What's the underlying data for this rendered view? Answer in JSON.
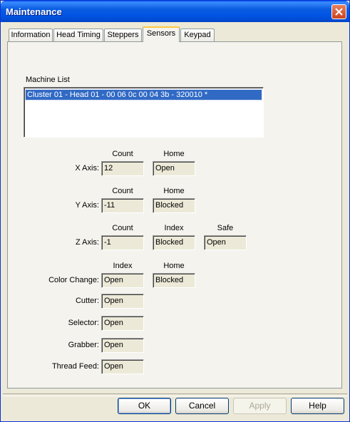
{
  "window": {
    "title": "Maintenance"
  },
  "tabs": [
    "Information",
    "Head Timing",
    "Steppers",
    "Sensors",
    "Keypad"
  ],
  "active_tab": "Sensors",
  "machine_list": {
    "label": "Machine List",
    "items": [
      "Cluster 01 - Head 01 - 00 06 0c 00 04 3b - 320010 *"
    ]
  },
  "column_headers": {
    "x_count": "Count",
    "x_home": "Home",
    "y_count": "Count",
    "y_home": "Home",
    "z_count": "Count",
    "z_index": "Index",
    "z_safe": "Safe",
    "cc_index": "Index",
    "cc_home": "Home"
  },
  "rows": {
    "x_axis": {
      "label": "X Axis:",
      "count": "12",
      "home": "Open"
    },
    "y_axis": {
      "label": "Y Axis:",
      "count": "-11",
      "home": "Blocked"
    },
    "z_axis": {
      "label": "Z Axis:",
      "count": "-1",
      "index": "Blocked",
      "safe": "Open"
    },
    "color_change": {
      "label": "Color Change:",
      "index": "Open",
      "home": "Blocked"
    },
    "cutter": {
      "label": "Cutter:",
      "value": "Open"
    },
    "selector": {
      "label": "Selector:",
      "value": "Open"
    },
    "grabber": {
      "label": "Grabber:",
      "value": "Open"
    },
    "thread_feed": {
      "label": "Thread Feed:",
      "value": "Open"
    }
  },
  "buttons": {
    "ok": "OK",
    "cancel": "Cancel",
    "apply": "Apply",
    "help": "Help"
  },
  "icons": {
    "close": "close-icon"
  }
}
